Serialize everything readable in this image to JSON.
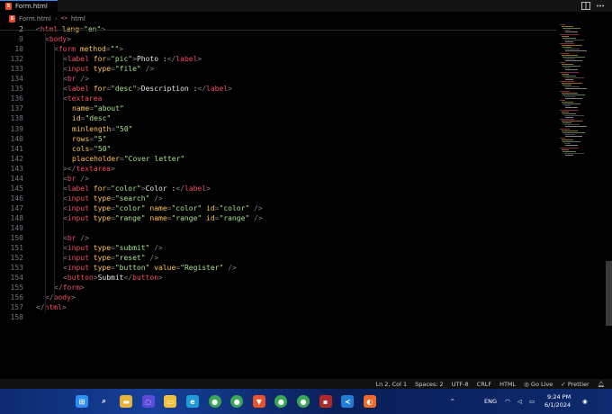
{
  "tabbar": {
    "tab_label": "Form.html",
    "tab_icon": "html5-icon",
    "actions": [
      "split-editor-icon",
      "more-actions-icon"
    ]
  },
  "breadcrumb": {
    "file": "Form.html",
    "symbol": "html"
  },
  "colors": {
    "bracket": "#808080",
    "tag": "#f24b60",
    "attribute": "#ffc54d",
    "string": "#a5e38a",
    "text": "#e6e6e6",
    "background": "#000000",
    "accent": "#3b8ee8"
  },
  "editor": {
    "lines": [
      {
        "n": "2",
        "indent": 0,
        "tokens": [
          [
            "p",
            "<"
          ],
          [
            "tag",
            "html"
          ],
          [
            "t",
            " "
          ],
          [
            "attr",
            "lang"
          ],
          [
            "p",
            "="
          ],
          [
            "str",
            "\"en\""
          ],
          [
            "p",
            ">"
          ]
        ]
      },
      {
        "n": "9",
        "indent": 1,
        "tokens": [
          [
            "p",
            "<"
          ],
          [
            "tag",
            "body"
          ],
          [
            "p",
            ">"
          ]
        ]
      },
      {
        "n": "10",
        "indent": 2,
        "tokens": [
          [
            "p",
            "<"
          ],
          [
            "tag",
            "form"
          ],
          [
            "t",
            " "
          ],
          [
            "attr",
            "method"
          ],
          [
            "p",
            "="
          ],
          [
            "str",
            "\"\""
          ],
          [
            "p",
            ">"
          ]
        ]
      },
      {
        "n": "132",
        "indent": 3,
        "tokens": [
          [
            "p",
            "<"
          ],
          [
            "tag",
            "label"
          ],
          [
            "t",
            " "
          ],
          [
            "attr",
            "for"
          ],
          [
            "p",
            "="
          ],
          [
            "str",
            "\"pic\""
          ],
          [
            "p",
            ">"
          ],
          [
            "txt",
            "Photo :"
          ],
          [
            "p",
            "</"
          ],
          [
            "tag",
            "label"
          ],
          [
            "p",
            ">"
          ]
        ]
      },
      {
        "n": "133",
        "indent": 3,
        "tokens": [
          [
            "p",
            "<"
          ],
          [
            "tag",
            "input"
          ],
          [
            "t",
            " "
          ],
          [
            "attr",
            "type"
          ],
          [
            "p",
            "="
          ],
          [
            "str",
            "\"file\""
          ],
          [
            "t",
            " "
          ],
          [
            "p",
            "/>"
          ]
        ]
      },
      {
        "n": "134",
        "indent": 3,
        "tokens": [
          [
            "p",
            "<"
          ],
          [
            "tag",
            "br"
          ],
          [
            "t",
            " "
          ],
          [
            "p",
            "/>"
          ]
        ]
      },
      {
        "n": "135",
        "indent": 3,
        "tokens": [
          [
            "p",
            "<"
          ],
          [
            "tag",
            "label"
          ],
          [
            "t",
            " "
          ],
          [
            "attr",
            "for"
          ],
          [
            "p",
            "="
          ],
          [
            "str",
            "\"desc\""
          ],
          [
            "p",
            ">"
          ],
          [
            "txt",
            "Description :"
          ],
          [
            "p",
            "</"
          ],
          [
            "tag",
            "label"
          ],
          [
            "p",
            ">"
          ]
        ]
      },
      {
        "n": "136",
        "indent": 3,
        "tokens": [
          [
            "p",
            "<"
          ],
          [
            "tag",
            "textarea"
          ]
        ]
      },
      {
        "n": "137",
        "indent": 4,
        "tokens": [
          [
            "attr",
            "name"
          ],
          [
            "p",
            "="
          ],
          [
            "str",
            "\"about\""
          ]
        ]
      },
      {
        "n": "138",
        "indent": 4,
        "tokens": [
          [
            "attr",
            "id"
          ],
          [
            "p",
            "="
          ],
          [
            "str",
            "\"desc\""
          ]
        ]
      },
      {
        "n": "139",
        "indent": 4,
        "tokens": [
          [
            "attr",
            "minlength"
          ],
          [
            "p",
            "="
          ],
          [
            "str",
            "\"50\""
          ]
        ]
      },
      {
        "n": "140",
        "indent": 4,
        "tokens": [
          [
            "attr",
            "rows"
          ],
          [
            "p",
            "="
          ],
          [
            "str",
            "\"5\""
          ]
        ]
      },
      {
        "n": "141",
        "indent": 4,
        "tokens": [
          [
            "attr",
            "cols"
          ],
          [
            "p",
            "="
          ],
          [
            "str",
            "\"50\""
          ]
        ]
      },
      {
        "n": "142",
        "indent": 4,
        "tokens": [
          [
            "attr",
            "placeholder"
          ],
          [
            "p",
            "="
          ],
          [
            "str",
            "\"Cover letter\""
          ]
        ]
      },
      {
        "n": "143",
        "indent": 3,
        "tokens": [
          [
            "p",
            "></"
          ],
          [
            "tag",
            "textarea"
          ],
          [
            "p",
            ">"
          ]
        ]
      },
      {
        "n": "144",
        "indent": 3,
        "tokens": [
          [
            "p",
            "<"
          ],
          [
            "tag",
            "br"
          ],
          [
            "t",
            " "
          ],
          [
            "p",
            "/>"
          ]
        ]
      },
      {
        "n": "145",
        "indent": 3,
        "tokens": [
          [
            "p",
            "<"
          ],
          [
            "tag",
            "label"
          ],
          [
            "t",
            " "
          ],
          [
            "attr",
            "for"
          ],
          [
            "p",
            "="
          ],
          [
            "str",
            "\"color\""
          ],
          [
            "p",
            ">"
          ],
          [
            "txt",
            "Color :"
          ],
          [
            "p",
            "</"
          ],
          [
            "tag",
            "label"
          ],
          [
            "p",
            ">"
          ]
        ]
      },
      {
        "n": "146",
        "indent": 3,
        "tokens": [
          [
            "p",
            "<"
          ],
          [
            "tag",
            "input"
          ],
          [
            "t",
            " "
          ],
          [
            "attr",
            "type"
          ],
          [
            "p",
            "="
          ],
          [
            "str",
            "\"search\""
          ],
          [
            "t",
            " "
          ],
          [
            "p",
            "/>"
          ]
        ]
      },
      {
        "n": "147",
        "indent": 3,
        "tokens": [
          [
            "p",
            "<"
          ],
          [
            "tag",
            "input"
          ],
          [
            "t",
            " "
          ],
          [
            "attr",
            "type"
          ],
          [
            "p",
            "="
          ],
          [
            "str",
            "\"color\""
          ],
          [
            "t",
            " "
          ],
          [
            "attr",
            "name"
          ],
          [
            "p",
            "="
          ],
          [
            "str",
            "\"color\""
          ],
          [
            "t",
            " "
          ],
          [
            "attr",
            "id"
          ],
          [
            "p",
            "="
          ],
          [
            "str",
            "\"color\""
          ],
          [
            "t",
            " "
          ],
          [
            "p",
            "/>"
          ]
        ]
      },
      {
        "n": "148",
        "indent": 3,
        "tokens": [
          [
            "p",
            "<"
          ],
          [
            "tag",
            "input"
          ],
          [
            "t",
            " "
          ],
          [
            "attr",
            "type"
          ],
          [
            "p",
            "="
          ],
          [
            "str",
            "\"range\""
          ],
          [
            "t",
            " "
          ],
          [
            "attr",
            "name"
          ],
          [
            "p",
            "="
          ],
          [
            "str",
            "\"range\""
          ],
          [
            "t",
            " "
          ],
          [
            "attr",
            "id"
          ],
          [
            "p",
            "="
          ],
          [
            "str",
            "\"range\""
          ],
          [
            "t",
            " "
          ],
          [
            "p",
            "/>"
          ]
        ]
      },
      {
        "n": "149",
        "indent": 3,
        "tokens": []
      },
      {
        "n": "150",
        "indent": 3,
        "tokens": [
          [
            "p",
            "<"
          ],
          [
            "tag",
            "br"
          ],
          [
            "t",
            " "
          ],
          [
            "p",
            "/>"
          ]
        ]
      },
      {
        "n": "151",
        "indent": 3,
        "tokens": [
          [
            "p",
            "<"
          ],
          [
            "tag",
            "input"
          ],
          [
            "t",
            " "
          ],
          [
            "attr",
            "type"
          ],
          [
            "p",
            "="
          ],
          [
            "str",
            "\"submit\""
          ],
          [
            "t",
            " "
          ],
          [
            "p",
            "/>"
          ]
        ]
      },
      {
        "n": "152",
        "indent": 3,
        "tokens": [
          [
            "p",
            "<"
          ],
          [
            "tag",
            "input"
          ],
          [
            "t",
            " "
          ],
          [
            "attr",
            "type"
          ],
          [
            "p",
            "="
          ],
          [
            "str",
            "\"reset\""
          ],
          [
            "t",
            " "
          ],
          [
            "p",
            "/>"
          ]
        ]
      },
      {
        "n": "153",
        "indent": 3,
        "tokens": [
          [
            "p",
            "<"
          ],
          [
            "tag",
            "input"
          ],
          [
            "t",
            " "
          ],
          [
            "attr",
            "type"
          ],
          [
            "p",
            "="
          ],
          [
            "str",
            "\"button\""
          ],
          [
            "t",
            " "
          ],
          [
            "attr",
            "value"
          ],
          [
            "p",
            "="
          ],
          [
            "str",
            "\"Register\""
          ],
          [
            "t",
            " "
          ],
          [
            "p",
            "/>"
          ]
        ]
      },
      {
        "n": "154",
        "indent": 3,
        "tokens": [
          [
            "p",
            "<"
          ],
          [
            "tag",
            "button"
          ],
          [
            "p",
            ">"
          ],
          [
            "txt",
            "Submit"
          ],
          [
            "p",
            "</"
          ],
          [
            "tag",
            "button"
          ],
          [
            "p",
            ">"
          ]
        ]
      },
      {
        "n": "155",
        "indent": 2,
        "tokens": [
          [
            "p",
            "</"
          ],
          [
            "tag",
            "form"
          ],
          [
            "p",
            ">"
          ]
        ]
      },
      {
        "n": "156",
        "indent": 1,
        "tokens": [
          [
            "p",
            "</"
          ],
          [
            "tag",
            "body"
          ],
          [
            "p",
            ">"
          ]
        ]
      },
      {
        "n": "157",
        "indent": 0,
        "tokens": [
          [
            "p",
            "</"
          ],
          [
            "tag",
            "html"
          ],
          [
            "p",
            ">"
          ]
        ]
      },
      {
        "n": "158",
        "indent": 0,
        "tokens": []
      }
    ]
  },
  "statusbar": {
    "position": "Ln 2, Col 1",
    "spaces": "Spaces: 2",
    "encoding": "UTF-8",
    "eol": "CRLF",
    "language": "HTML",
    "golive": "Go Live",
    "prettier": "Prettier"
  },
  "taskbar": {
    "apps": [
      "start-icon",
      "search-icon",
      "file-explorer-icon",
      "messenger-icon",
      "folder-icon",
      "edge-icon",
      "chrome-icon",
      "chrome-icon",
      "brave-icon",
      "chrome-icon",
      "chrome-icon",
      "app-icon",
      "vscode-icon",
      "firefox-icon"
    ],
    "lang": "ENG",
    "time": "9:24 PM",
    "date": "6/1/2024"
  }
}
